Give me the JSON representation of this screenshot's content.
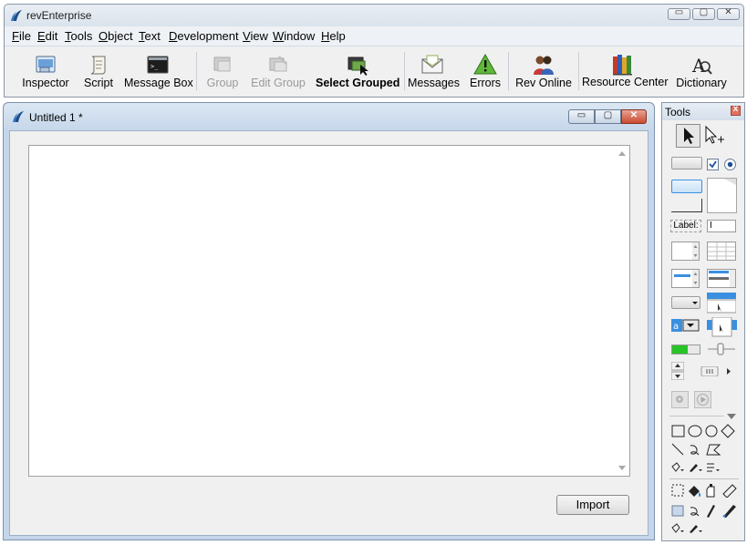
{
  "app": {
    "title": "revEnterprise",
    "window_controls": [
      "minimize",
      "maximize",
      "close"
    ]
  },
  "menubar": {
    "items": [
      "File",
      "Edit",
      "Tools",
      "Object",
      "Text",
      "Development",
      "View",
      "Window",
      "Help"
    ]
  },
  "toolbar": {
    "items": [
      {
        "label": "Inspector",
        "icon": "inspector-icon",
        "enabled": true
      },
      {
        "label": "Script",
        "icon": "script-scroll-icon",
        "enabled": true
      },
      {
        "label": "Message Box",
        "icon": "message-box-icon",
        "enabled": true
      },
      {
        "label": "Group",
        "icon": "group-icon",
        "enabled": false
      },
      {
        "label": "Edit Group",
        "icon": "edit-group-icon",
        "enabled": false
      },
      {
        "label": "Select Grouped",
        "icon": "select-grouped-icon",
        "enabled": true
      },
      {
        "label": "Messages",
        "icon": "envelope-icon",
        "enabled": true
      },
      {
        "label": "Errors",
        "icon": "warning-icon",
        "enabled": true
      },
      {
        "label": "Rev Online",
        "icon": "people-icon",
        "enabled": true
      },
      {
        "label": "Resource Center",
        "icon": "books-icon",
        "enabled": true
      },
      {
        "label": "Dictionary",
        "icon": "dictionary-icon",
        "enabled": true
      }
    ]
  },
  "document": {
    "title": "Untitled 1 *",
    "text_area": "",
    "import_label": "Import"
  },
  "tools_palette": {
    "title": "Tools",
    "close_glyph": "x",
    "label_tool_text": "Label:",
    "text_cursor_glyph": "I",
    "scrollbar_glyph": "|||"
  },
  "colors": {
    "accent_blue": "#3b8fe0",
    "progress_green": "#27c427",
    "close_red": "#c94a30",
    "window_frame": "#c5d6ea"
  }
}
